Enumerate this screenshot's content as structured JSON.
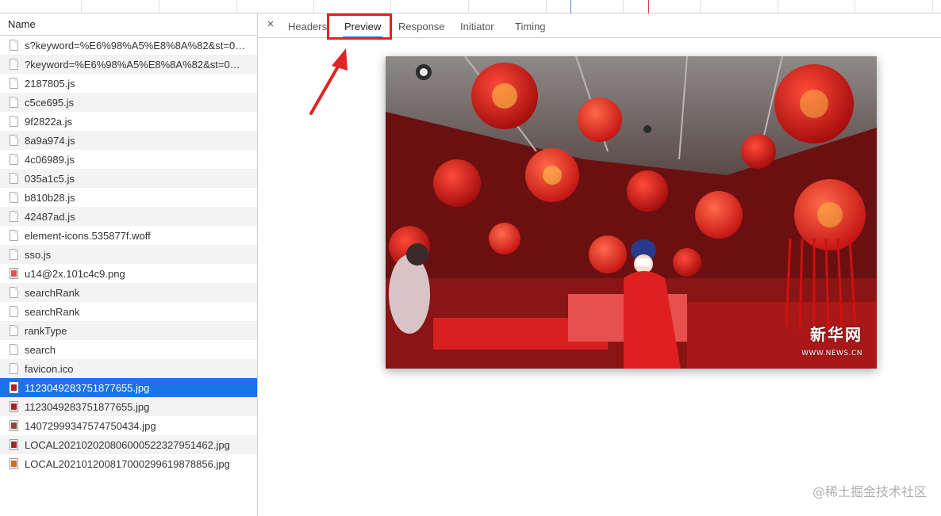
{
  "columns": {
    "name_header": "Name"
  },
  "requests": [
    {
      "label": "s?keyword=%E6%98%A5%E8%8A%82&st=0&...",
      "icon": "document-icon",
      "selected": false
    },
    {
      "label": "?keyword=%E6%98%A5%E8%8A%82&st=0&_...",
      "icon": "document-icon",
      "selected": false
    },
    {
      "label": "2187805.js",
      "icon": "document-icon",
      "selected": false
    },
    {
      "label": "c5ce695.js",
      "icon": "document-icon",
      "selected": false
    },
    {
      "label": "9f2822a.js",
      "icon": "document-icon",
      "selected": false
    },
    {
      "label": "8a9a974.js",
      "icon": "document-icon",
      "selected": false
    },
    {
      "label": "4c06989.js",
      "icon": "document-icon",
      "selected": false
    },
    {
      "label": "035a1c5.js",
      "icon": "document-icon",
      "selected": false
    },
    {
      "label": "b810b28.js",
      "icon": "document-icon",
      "selected": false
    },
    {
      "label": "42487ad.js",
      "icon": "document-icon",
      "selected": false
    },
    {
      "label": "element-icons.535877f.woff",
      "icon": "document-icon",
      "selected": false
    },
    {
      "label": "sso.js",
      "icon": "document-icon",
      "selected": false
    },
    {
      "label": "u14@2x.101c4c9.png",
      "icon": "image-icon",
      "thumb": "#e05050",
      "selected": false
    },
    {
      "label": "searchRank",
      "icon": "document-icon",
      "selected": false
    },
    {
      "label": "searchRank",
      "icon": "document-icon",
      "selected": false
    },
    {
      "label": "rankType",
      "icon": "document-icon",
      "selected": false
    },
    {
      "label": "search",
      "icon": "document-icon",
      "selected": false
    },
    {
      "label": "favicon.ico",
      "icon": "document-icon",
      "selected": false
    },
    {
      "label": "1123049283751877655.jpg",
      "icon": "image-icon",
      "thumb": "#b02020",
      "selected": true
    },
    {
      "label": "1123049283751877655.jpg",
      "icon": "image-icon",
      "thumb": "#b02020",
      "selected": false
    },
    {
      "label": "1407299934757475043‌4.jpg",
      "icon": "image-icon",
      "thumb": "#8a4a3a",
      "selected": false
    },
    {
      "label": "LOCAL20210202080600052232795146‌2.jpg",
      "icon": "image-icon",
      "thumb": "#b02020",
      "selected": false
    },
    {
      "label": "LOCAL20210120081700029961987885‌6.jpg",
      "icon": "image-icon",
      "thumb": "#d06a2a",
      "selected": false
    }
  ],
  "detail": {
    "close_symbol": "×",
    "tabs": [
      {
        "label": "Headers",
        "active": false
      },
      {
        "label": "Preview",
        "active": true
      },
      {
        "label": "Response",
        "active": false
      },
      {
        "label": "Initiator",
        "active": false
      },
      {
        "label": "Timing",
        "active": false
      }
    ]
  },
  "preview": {
    "watermark_logo": "新华网",
    "watermark_url": "WWW.NEWS.CN"
  },
  "site_watermark": "@稀土掘金技术社区",
  "colors": {
    "selection": "#1a73e8",
    "highlight": "#e02424",
    "timeline_blue": "#4a7fd6",
    "timeline_red": "#d93a3a"
  }
}
